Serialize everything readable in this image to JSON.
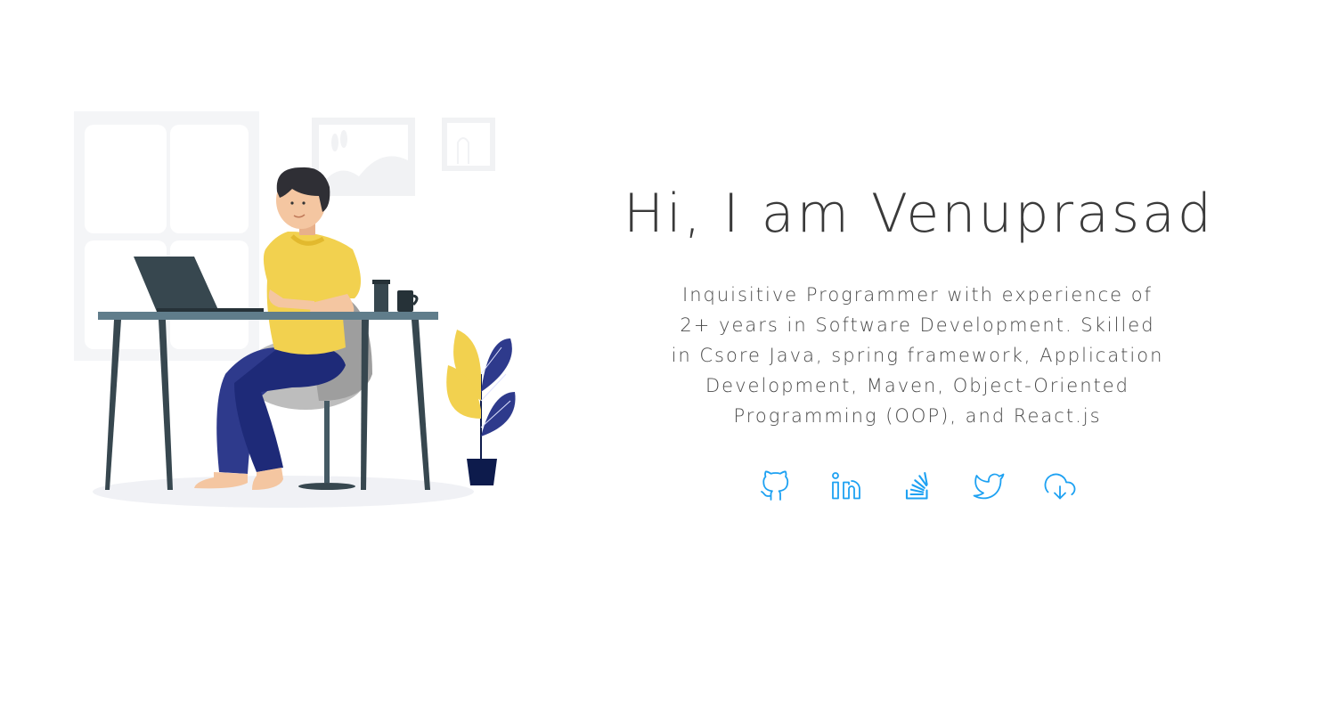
{
  "hero": {
    "greeting": "Hi, I am Venuprasad",
    "bio": "Inquisitive Programmer with experience of 2+ years in Software Development. Skilled in Csore Java, spring framework, Application Development, Maven, Object-Oriented Programming (OOP), and React.js"
  },
  "colors": {
    "icon_accent": "#1da1f2",
    "shirt": "#f2d14f",
    "pants": "#2e3a8c",
    "desk": "#37474f"
  },
  "socials": [
    {
      "icon": "github-icon"
    },
    {
      "icon": "linkedin-icon"
    },
    {
      "icon": "stackoverflow-icon"
    },
    {
      "icon": "twitter-icon"
    },
    {
      "icon": "cloud-download-icon"
    }
  ]
}
